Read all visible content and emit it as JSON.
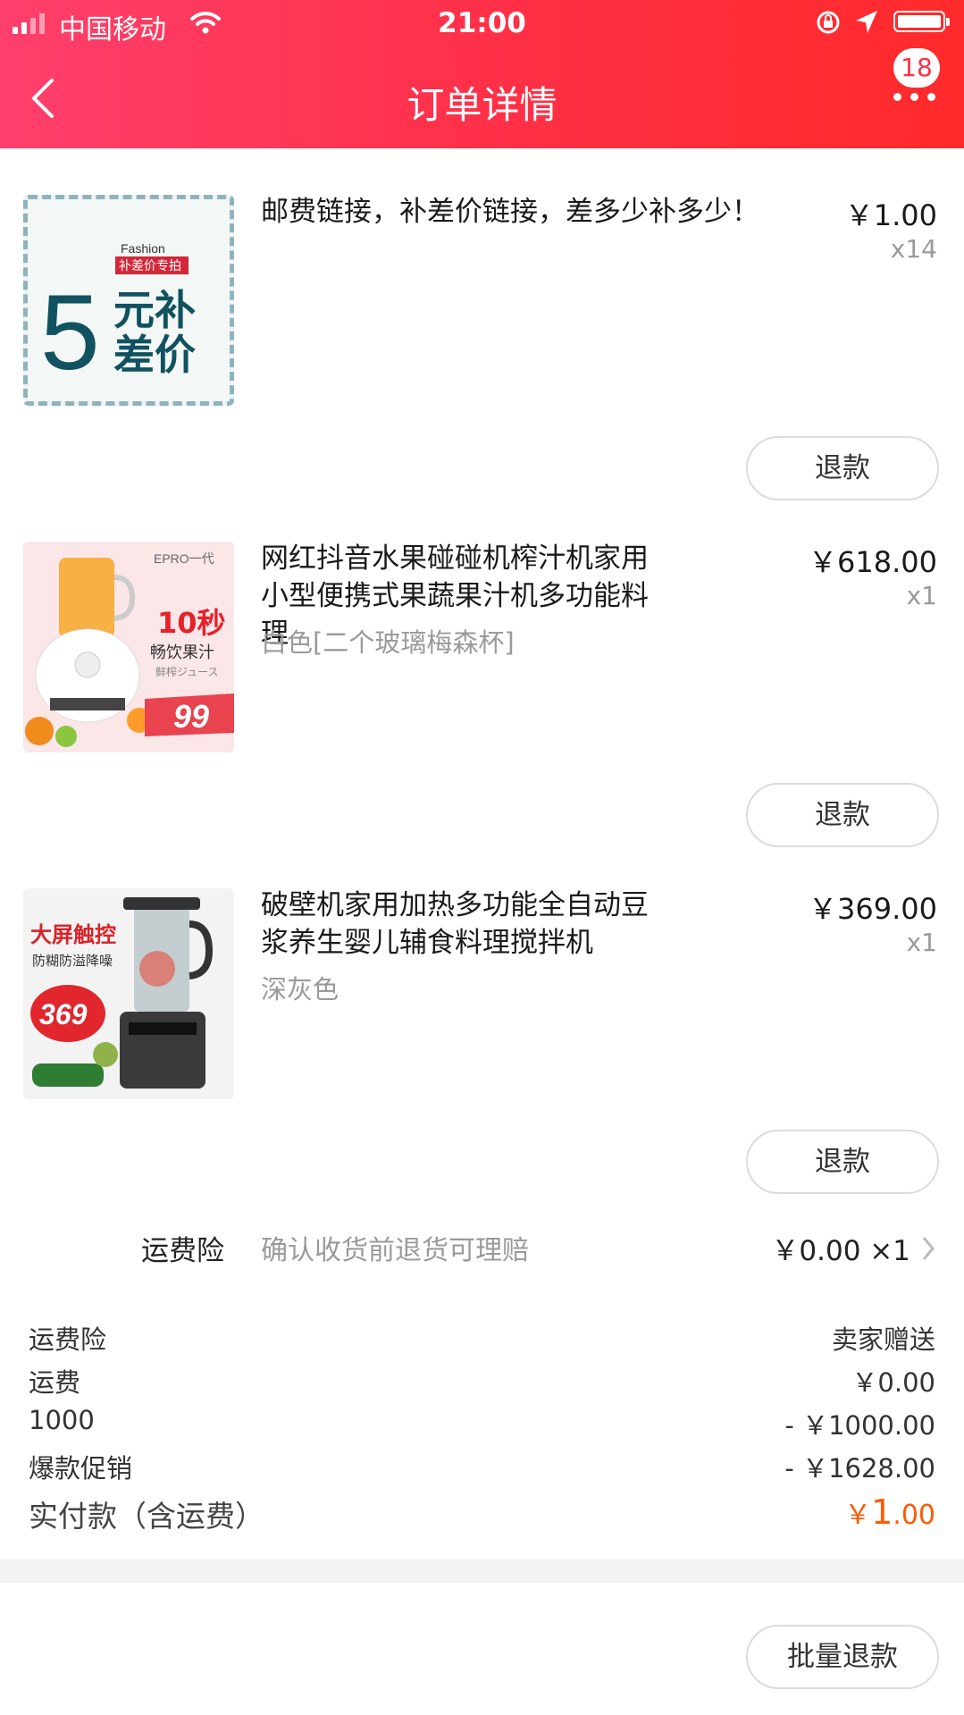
{
  "status_bar": {
    "carrier": "中国移动",
    "time": "21:00"
  },
  "header": {
    "title": "订单详情",
    "badge": "18"
  },
  "items": [
    {
      "name": "邮费链接，补差价链接，差多少补多少！",
      "spec": "",
      "price": "￥1.00",
      "qty": "x14",
      "refund_label": "退款",
      "thumb": {
        "line1": "Fashion",
        "line2": "补差价专拍",
        "big": "5",
        "text1": "元补",
        "text2": "差价"
      }
    },
    {
      "name": "网红抖音水果碰碰机榨汁机家用小型便携式果蔬果汁机多功能料理",
      "spec": "白色[二个玻璃梅森杯]",
      "price": "￥618.00",
      "qty": "x1",
      "refund_label": "退款",
      "thumb": {
        "brand": "EPRO一代",
        "t1": "10秒",
        "t2": "畅饮果汁",
        "t3": "鲜榨ジュース",
        "price": "99"
      }
    },
    {
      "name": "破壁机家用加热多功能全自动豆浆养生婴儿辅食料理搅拌机",
      "spec": "深灰色",
      "price": "￥369.00",
      "qty": "x1",
      "refund_label": "退款",
      "thumb": {
        "t1": "大屏触控",
        "t2": "防糊防溢降噪",
        "price": "369"
      }
    }
  ],
  "insurance": {
    "label": "运费险",
    "desc": "确认收货前退货可理赔",
    "price": "￥0.00 ×1"
  },
  "summary": [
    {
      "label": "运费险",
      "value": "卖家赠送"
    },
    {
      "label": "运费",
      "value": "￥0.00"
    },
    {
      "label": "1000",
      "value": "- ￥1000.00"
    },
    {
      "label": "爆款促销",
      "value": "- ￥1628.00"
    }
  ],
  "total": {
    "label": "实付款（含运费）",
    "currency": "￥",
    "int": "1",
    "dec": ".00"
  },
  "bulk_refund_label": "批量退款",
  "colors": {
    "header_start": "#ff3f6c",
    "header_end": "#ff2a2a",
    "total_price": "#ff5a00"
  }
}
